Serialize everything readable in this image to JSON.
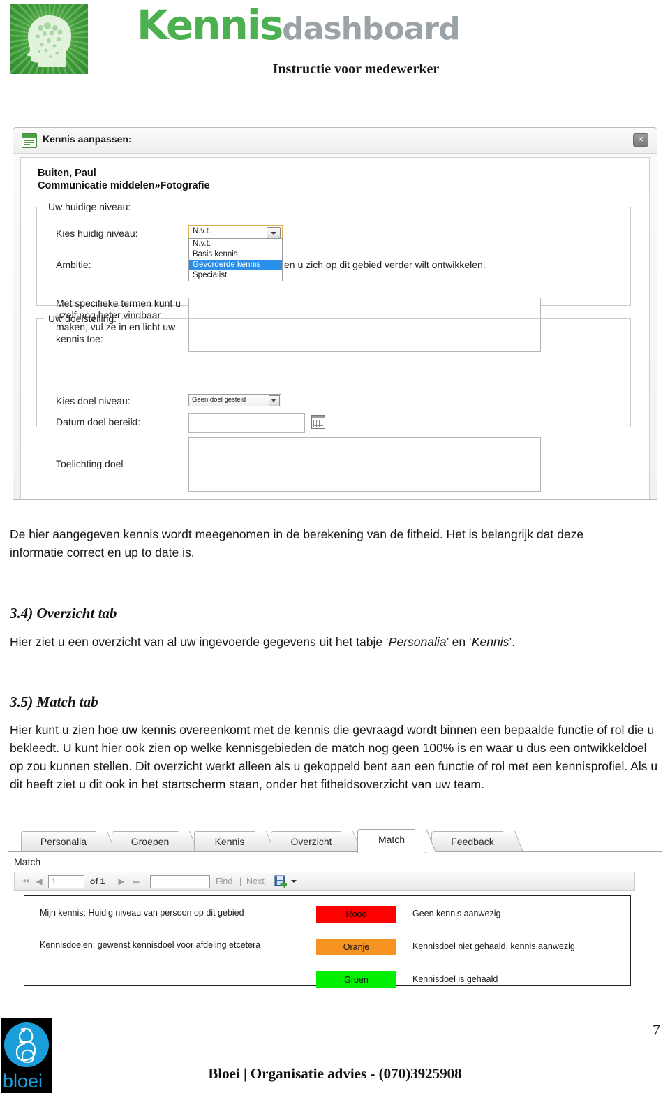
{
  "header": {
    "brand_primary": "Kennis",
    "brand_secondary": "dashboard",
    "subtitle": "Instructie voor medewerker",
    "logo_icon": "head-network-icon",
    "brand_color": "#4caf50",
    "brand_secondary_color": "#9aa3a8"
  },
  "dialog": {
    "icon": "window-document-icon",
    "title": "Kennis aanpassen:",
    "close_label": "✕",
    "person_name": "Buiten, Paul",
    "person_path": "Communicatie middelen»Fotografie",
    "group_current": {
      "legend": "Uw huidige niveau:",
      "level_label": "Kies huidig niveau:",
      "level_value": "N.v.t.",
      "level_options": [
        "N.v.t.",
        "Basis kennis",
        "Gevorderde kennis",
        "Specialist"
      ],
      "level_selected_option": "Gevorderde kennis",
      "ambition_label": "Ambitie:",
      "ambition_text": "en u zich op dit gebied verder wilt ontwikkelen.",
      "terms_label": "Met specifieke termen kunt u uzelf nog beter vindbaar maken, vul ze in en licht uw kennis toe:",
      "terms_value": ""
    },
    "group_goal": {
      "legend": "Uw doelstelling:",
      "goal_level_label": "Kies doel niveau:",
      "goal_level_value": "Geen doel gesteld",
      "goal_date_label": "Datum doel bereikt:",
      "goal_date_value": "",
      "calendar_icon": "calendar-icon",
      "goal_note_label": "Toelichting doel",
      "goal_note_value": ""
    }
  },
  "content": {
    "intro_paragraph": "De hier aangegeven kennis wordt meegenomen in de berekening van de fitheid. Het is belangrijk dat deze informatie correct en up to date is.",
    "section_34_heading": "3.4) Overzicht tab",
    "section_34_text_a": "Hier ziet u een overzicht van al uw ingevoerde gegevens uit het tabje ‘",
    "section_34_italic_1": "Personalia",
    "section_34_text_b": "’ en ‘",
    "section_34_italic_2": "Kennis",
    "section_34_text_c": "’.",
    "section_35_heading": "3.5) Match tab",
    "section_35_text": "Hier kunt u zien hoe uw kennis overeenkomt met de kennis die gevraagd wordt binnen een bepaalde functie of rol die u bekleedt. U kunt hier ook zien op welke kennisgebieden de match nog geen 100%  is en waar u dus een ontwikkeldoel op zou kunnen stellen. Dit overzicht werkt alleen als u gekoppeld bent aan een functie of rol met een kennisprofiel. Als u dit heeft ziet u dit ook in het startscherm staan, onder het fitheidsoverzicht van uw team."
  },
  "match_screen": {
    "tabs": [
      {
        "label": "Personalia",
        "active": false
      },
      {
        "label": "Groepen",
        "active": false
      },
      {
        "label": "Kennis",
        "active": false
      },
      {
        "label": "Overzicht",
        "active": false
      },
      {
        "label": "Match",
        "active": true
      },
      {
        "label": "Feedback",
        "active": false
      }
    ],
    "panel_title": "Match",
    "toolbar": {
      "first_icon": "first-page-icon",
      "prev_icon": "previous-page-icon",
      "page_value": "1",
      "of_pages": "of 1",
      "next_icon": "next-page-icon",
      "last_icon": "last-page-icon",
      "find_input_value": "",
      "find_label": "Find",
      "separator": "|",
      "next_label": "Next",
      "export_icon": "export-save-icon",
      "export_dropdown_icon": "chevron-down-icon"
    },
    "legend": {
      "note_1": "Mijn kennis: Huidig niveau van persoon op dit gebied",
      "note_2": "Kennisdoelen: gewenst kennisdoel voor afdeling etcetera",
      "rows": [
        {
          "swatch_label": "Rood",
          "color": "#ff0000",
          "description": "Geen kennis aanwezig"
        },
        {
          "swatch_label": "Oranje",
          "color": "#f79321",
          "description": "Kennisdoel niet gehaald, kennis aanwezig"
        },
        {
          "swatch_label": "Groen",
          "color": "#00ee00",
          "description": "Kennisdoel is gehaald"
        }
      ]
    }
  },
  "footer": {
    "logo_word": "bloei",
    "logo_icon": "bloei-logo-icon",
    "text": "Bloei | Organisatie advies -  (070)3925908",
    "page_number": "7"
  }
}
